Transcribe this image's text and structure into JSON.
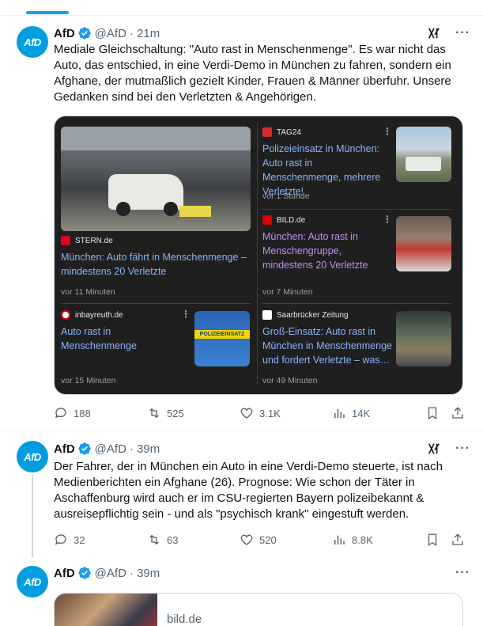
{
  "tweets": [
    {
      "avatar_text": "AfD",
      "name": "AfD",
      "handle": "@AfD",
      "time": "· 21m",
      "text": "Mediale Gleichschaltung: \"Auto rast in Menschenmenge\". Es war nicht das Auto, das  entschied, in eine Verdi-Demo in München zu fahren, sondern ein Afghane, der mutmaßlich gezielt Kinder, Frauen & Männer überfuhr. Unsere Gedanken sind bei den Verletzten & Angehörigen.",
      "replies": "188",
      "reposts": "525",
      "likes": "3.1K",
      "views": "14K"
    },
    {
      "avatar_text": "AfD",
      "name": "AfD",
      "handle": "@AfD",
      "time": "· 39m",
      "text": "Der Fahrer, der in München ein Auto in eine Verdi-Demo steuerte, ist nach Medienberichten ein Afghane (26). Prognose: Wie schon der Täter in Aschaffenburg wird auch er im CSU-regierten Bayern polizeibekannt & ausreisepflichtig sein - und als \"psychisch krank\" eingestuft werden.",
      "replies": "32",
      "reposts": "63",
      "likes": "520",
      "views": "8.8K"
    },
    {
      "avatar_text": "AfD",
      "name": "AfD",
      "handle": "@AfD",
      "time": "· 39m",
      "link_domain": "bild.de"
    }
  ],
  "news_card": {
    "items": [
      {
        "source": "STERN.de",
        "headline": "München: Auto fährt in Menschenmenge – mindestens 20 Verletzte",
        "time": "vor 11 Minuten"
      },
      {
        "source": "TAG24",
        "headline": "Polizeieinsatz in München: Auto rast in Menschenmenge, mehrere Verletzte!",
        "time": "vor 1 Stunde"
      },
      {
        "source": "BILD.de",
        "headline": "München: Auto rast in Menschengruppe, mindestens 20 Verletzte",
        "time": "vor 7 Minuten"
      },
      {
        "source": "inbayreuth.de",
        "headline": "Auto rast in Menschenmenge",
        "time": "vor 15 Minuten",
        "thumb_text": "POLIZEIEINSATZ"
      },
      {
        "source": "Saarbrücker Zeitung",
        "headline": "Groß-Einsatz: Auto rast in München in Menschenmenge und fordert Verletzte – was…",
        "time": "vor 49 Minuten"
      }
    ]
  },
  "colors": {
    "accent": "#1d9bf0",
    "avatar_bg": "#009ee0",
    "card_bg": "#1f1f1f",
    "news_link": "#8ab4f8"
  }
}
